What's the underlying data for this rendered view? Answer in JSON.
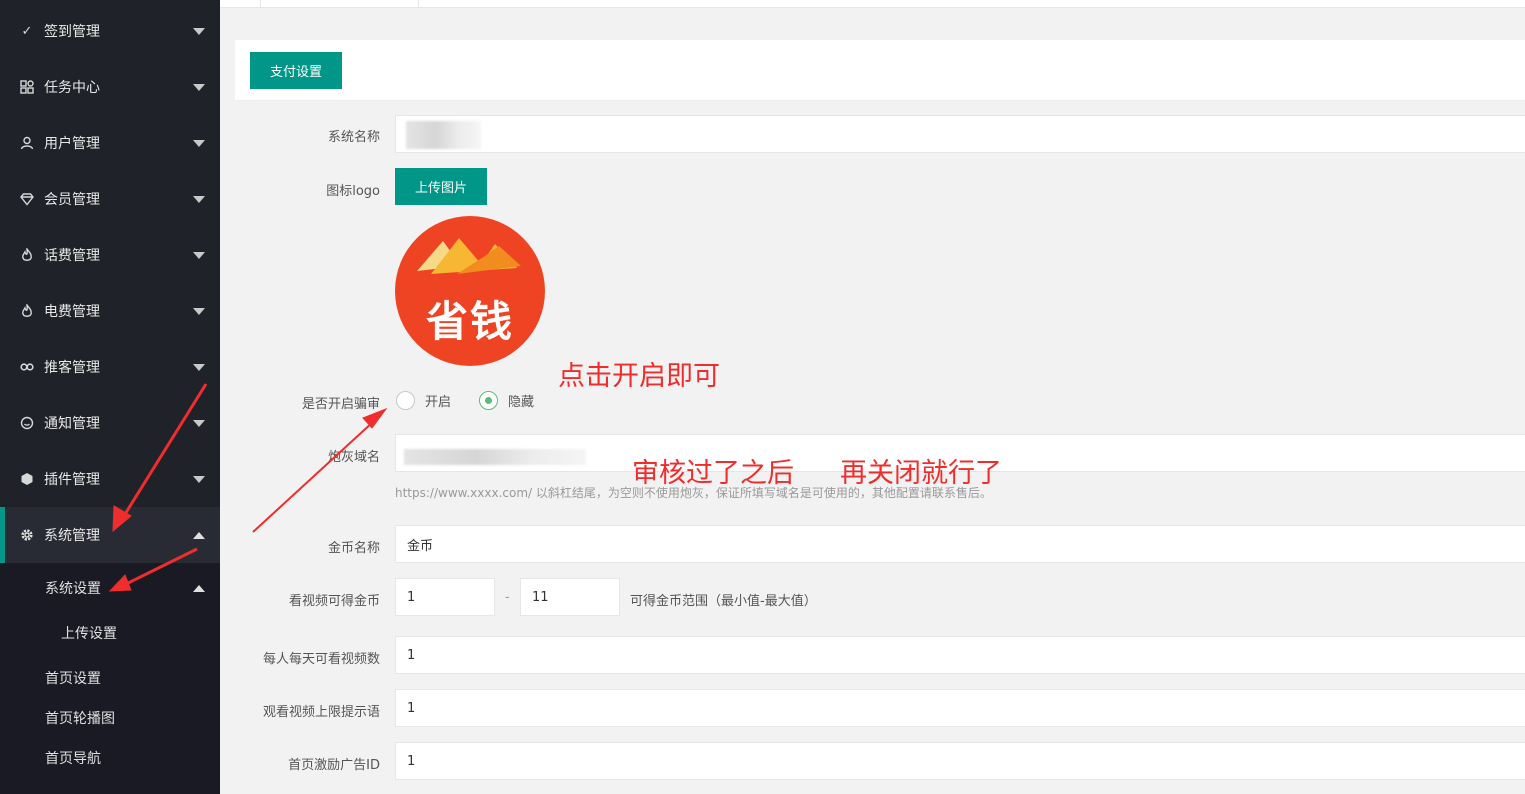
{
  "sidebar": {
    "items": [
      {
        "label": "签到管理",
        "icon": "check-icon"
      },
      {
        "label": "任务中心",
        "icon": "apps-icon"
      },
      {
        "label": "用户管理",
        "icon": "user-icon"
      },
      {
        "label": "会员管理",
        "icon": "diamond-icon"
      },
      {
        "label": "话费管理",
        "icon": "fire-icon"
      },
      {
        "label": "电费管理",
        "icon": "fire-icon"
      },
      {
        "label": "推客管理",
        "icon": "link-icon"
      },
      {
        "label": "通知管理",
        "icon": "smile-icon"
      },
      {
        "label": "插件管理",
        "icon": "cube-icon"
      },
      {
        "label": "系统管理",
        "icon": "gear-icon"
      }
    ],
    "sub_items": {
      "system_settings": "系统设置",
      "upload_settings": "上传设置",
      "home_settings": "首页设置",
      "home_carousel": "首页轮播图",
      "home_nav": "首页导航"
    }
  },
  "header": {
    "pay_settings_button": "支付设置"
  },
  "form": {
    "system_name_label": "系统名称",
    "icon_logo_label": "图标logo",
    "upload_button": "上传图片",
    "logo_text": "省钱",
    "review_label": "是否开启骗审",
    "radio_open": "开启",
    "radio_hide": "隐藏",
    "cannon_domain_label": "炮灰域名",
    "cannon_domain_hint": "https://www.xxxx.com/ 以斜杠结尾，为空则不使用炮灰，保证所填写域名是可使用的，其他配置请联系售后。",
    "coin_name_label": "金币名称",
    "coin_name_value": "金币",
    "video_coin_label": "看视频可得金币",
    "video_coin_min": "1",
    "range_separator": "-",
    "video_coin_max": "11",
    "video_coin_hint": "可得金币范围（最小值-最大值）",
    "daily_videos_label": "每人每天可看视频数",
    "daily_videos_value": "1",
    "limit_tip_label": "观看视频上限提示语",
    "limit_tip_value": "1",
    "home_ad_label": "首页激励广告ID",
    "home_ad_value": "1"
  },
  "annotations": {
    "click_open": "点击开启即可",
    "after_review": "审核过了之后",
    "then_close": "再关闭就行了"
  },
  "colors": {
    "accent": "#009688",
    "sidebar_bg": "#20222a",
    "annotation": "#f02d2d",
    "logo_bg": "#ef4423"
  }
}
